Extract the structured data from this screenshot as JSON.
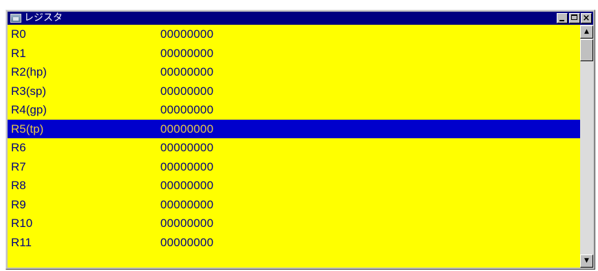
{
  "window": {
    "title": "レジスタ",
    "icon": "register-window-icon",
    "controls": {
      "minimize": "minimize-icon",
      "maximize": "maximize-icon",
      "close": "×"
    }
  },
  "colors": {
    "background": "#ffff00",
    "text": "#000080",
    "selected_background": "#0000cc",
    "selected_text": "#e6c84a",
    "titlebar": "#000080"
  },
  "registers": [
    {
      "name": "R0",
      "value": "00000000"
    },
    {
      "name": "R1",
      "value": "00000000"
    },
    {
      "name": "R2(hp)",
      "value": "00000000"
    },
    {
      "name": "R3(sp)",
      "value": "00000000"
    },
    {
      "name": "R4(gp)",
      "value": "00000000"
    },
    {
      "name": "R5(tp)",
      "value": "00000000",
      "selected": true
    },
    {
      "name": "R6",
      "value": "00000000"
    },
    {
      "name": "R7",
      "value": "00000000"
    },
    {
      "name": "R8",
      "value": "00000000"
    },
    {
      "name": "R9",
      "value": "00000000"
    },
    {
      "name": "R10",
      "value": "00000000"
    },
    {
      "name": "R11",
      "value": "00000000"
    }
  ],
  "scrollbar": {
    "up_arrow": "▲",
    "down_arrow": "▼"
  }
}
